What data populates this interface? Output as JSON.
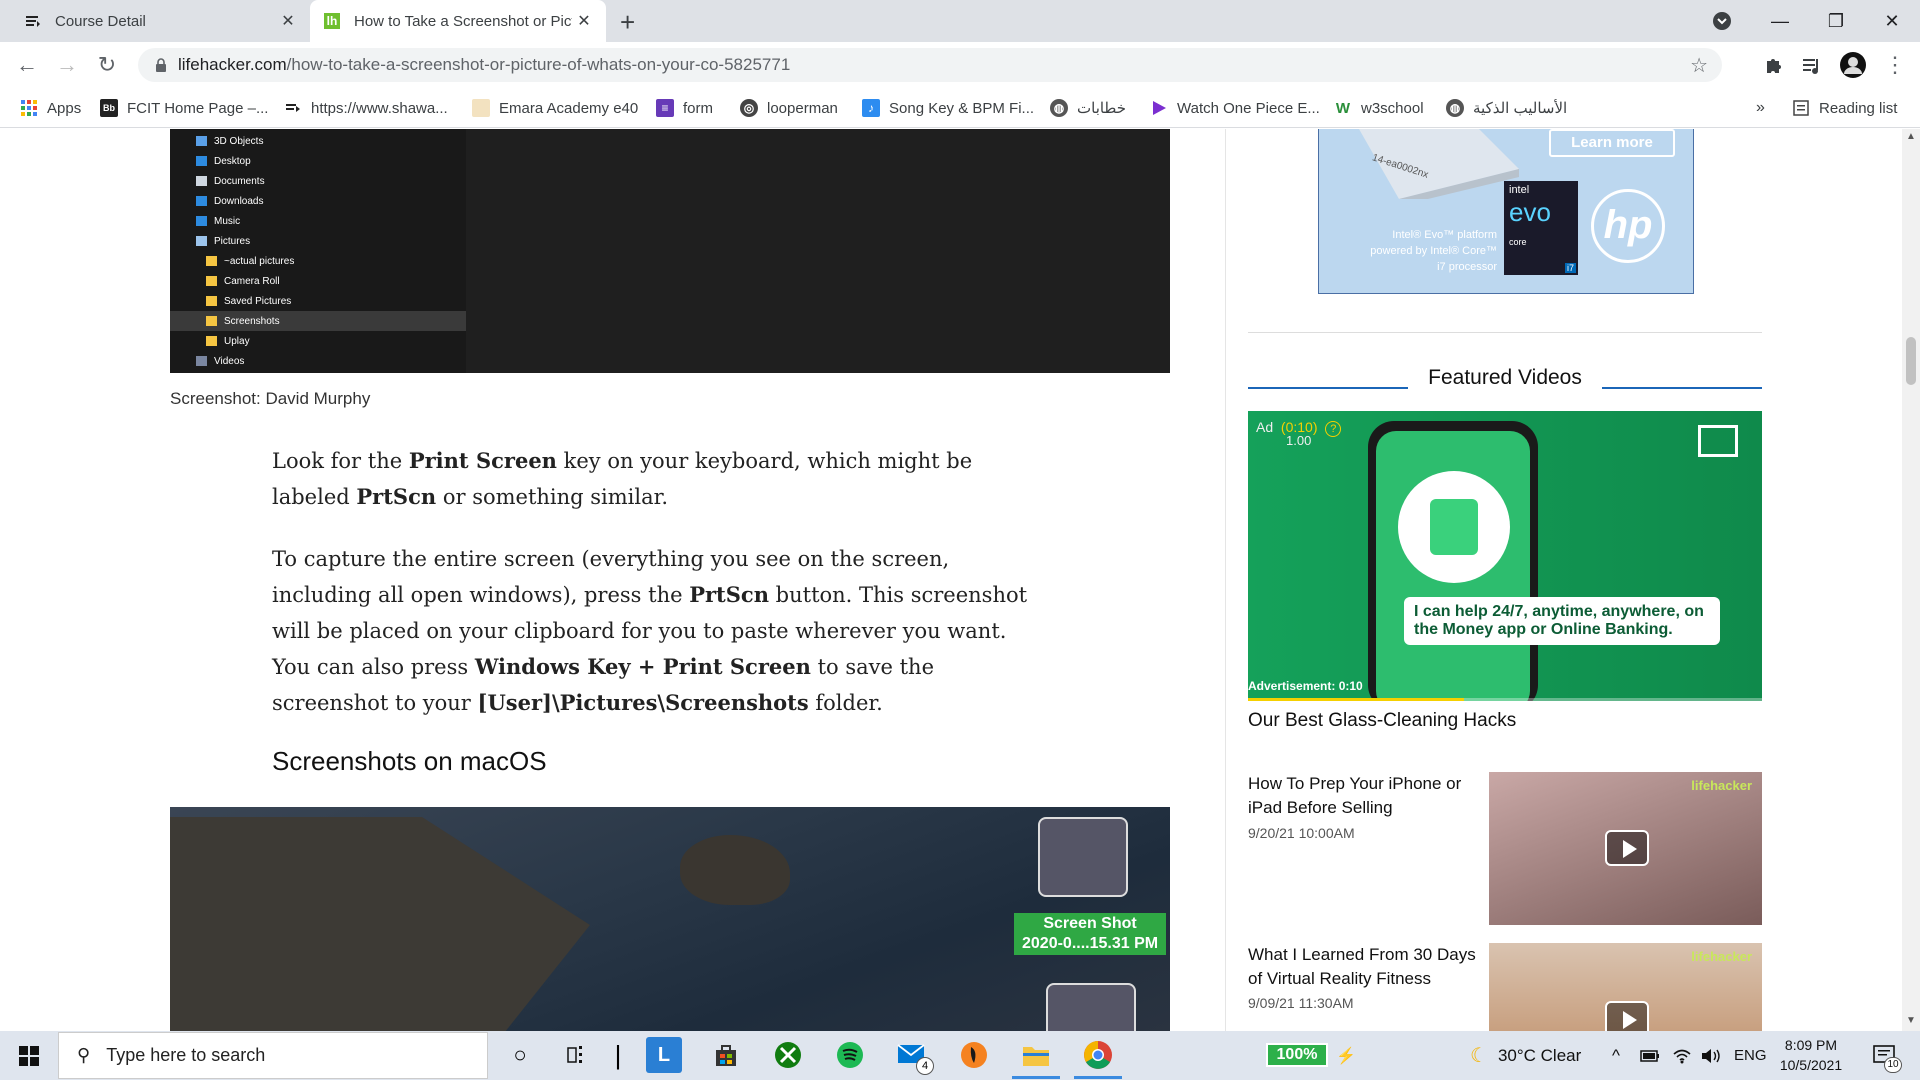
{
  "tabs": [
    {
      "title": "Course Detail"
    },
    {
      "title": "How to Take a Screenshot or Pict"
    }
  ],
  "omnibox": {
    "domain": "lifehacker.com",
    "path": "/how-to-take-a-screenshot-or-picture-of-whats-on-your-co-5825771"
  },
  "bookmarks": [
    {
      "label": "Apps"
    },
    {
      "label": "FCIT Home Page –..."
    },
    {
      "label": "https://www.shawa..."
    },
    {
      "label": "Emara Academy e40"
    },
    {
      "label": "form"
    },
    {
      "label": "looperman"
    },
    {
      "label": "Song Key & BPM Fi..."
    },
    {
      "label": "خطابات"
    },
    {
      "label": "Watch One Piece E..."
    },
    {
      "label": "w3school"
    },
    {
      "label": "الأساليب الذكية"
    }
  ],
  "reading_list": "Reading list",
  "explorer": {
    "items": [
      "3D Objects",
      "Desktop",
      "Documents",
      "Downloads",
      "Music",
      "Pictures",
      "~actual pictures",
      "Camera Roll",
      "Saved Pictures",
      "Screenshots",
      "Uplay",
      "Videos"
    ]
  },
  "article": {
    "caption": "Screenshot: David Murphy",
    "p1": [
      "Look for the ",
      "Print Screen",
      " key on your keyboard, which might be labeled ",
      "PrtScn",
      " or something similar."
    ],
    "p2": [
      "To capture the entire screen (everything you see on the screen, including all open windows), press the ",
      "PrtScn",
      " button. This screenshot will be placed on your clipboard for you to paste wherever you want. You can also press ",
      "Windows Key + Print Screen",
      " to save the screenshot to your ",
      "[User]\\Pictures\\Screenshots",
      " folder."
    ],
    "h2": "Screenshots on macOS",
    "mac_label_1": "Screen Shot",
    "mac_label_2": "2020-0....15.31 PM"
  },
  "sidebar": {
    "hp_ad": {
      "learn_more": "Learn more",
      "model": "14-ea0002nx",
      "intel": "intel",
      "evo": "evo",
      "core": "core",
      "i7": "i7",
      "copy": "Intel® Evo™ platform powered by Intel® Core™ i7 processor",
      "hp": "hp"
    },
    "featured_heading": "Featured Videos",
    "video": {
      "ad_label": "Ad",
      "countdown": "(0:10)",
      "help": "?",
      "timer": "1.00",
      "message": "I can help 24/7, anytime, anywhere, on the Money app or Online Banking.",
      "ad_time": "Advertisement: 0:10",
      "progress": 0.42
    },
    "current_title": "Our Best Glass-Cleaning Hacks",
    "videos": [
      {
        "title": "How To Prep Your iPhone or iPad Before Selling",
        "date": "9/20/21 10:00AM",
        "brand": "lifehacker"
      },
      {
        "title": "What I Learned From 30 Days of Virtual Reality Fitness",
        "date": "9/09/21 11:30AM",
        "brand": "lifehacker"
      }
    ]
  },
  "taskbar": {
    "search_placeholder": "Type here to search",
    "mail_badge": "4",
    "battery": "100%",
    "weather": "30°C  Clear",
    "lang": "ENG",
    "time": "8:09 PM",
    "date": "10/5/2021",
    "notif_count": "10"
  }
}
